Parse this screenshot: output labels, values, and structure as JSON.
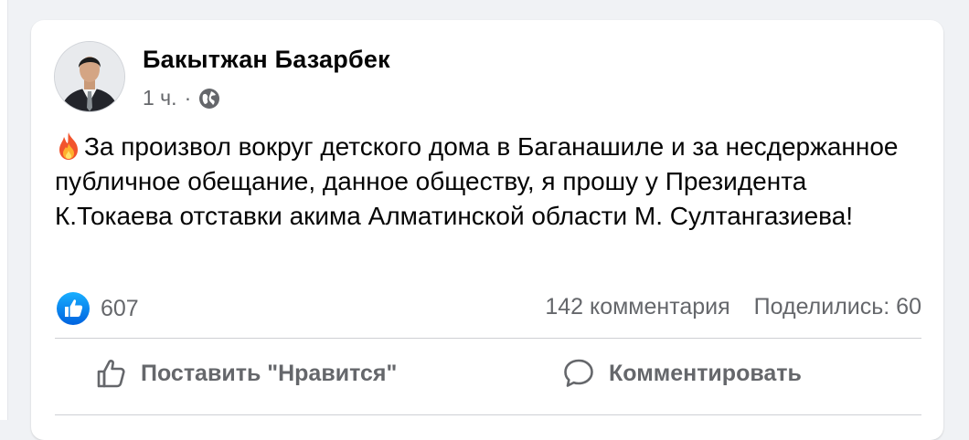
{
  "post": {
    "author": "Бакытжан Базарбек",
    "time": "1 ч.",
    "separator": "·",
    "audience_icon": "globe-icon",
    "emoji_icon": "fire-icon",
    "text": "За произвол вокруг детского дома в Баганашиле и за несдержанное публичное обещание, данное обществу, я прошу у Президента К.Токаева отставки акима Алматинской области М. Султангазиева!"
  },
  "stats": {
    "reaction_icon": "like-badge-icon",
    "likes": "607",
    "comments": "142 комментария",
    "shares": "Поделились: 60"
  },
  "actions": {
    "like_label": "Поставить \"Нравится\"",
    "comment_label": "Комментировать"
  },
  "colors": {
    "accent": "#1877f2",
    "secondary_text": "#65676b",
    "primary_text": "#050505",
    "background": "#f0f2f5"
  }
}
